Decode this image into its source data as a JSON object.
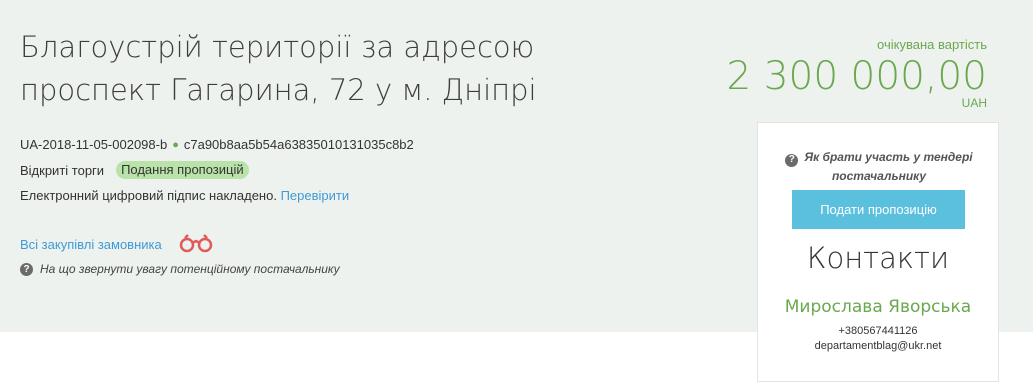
{
  "tender": {
    "title_line1": "Благоустрій території за адресою",
    "title_line2": "проспект Гагарина, 72 у м. Дніпрі",
    "id": "UA-2018-11-05-002098-b",
    "hash": "c7a90b8aa5b54a63835010131035c8b2",
    "procedure": "Відкриті торги",
    "status_badge": "Подання пропозицій",
    "signature_text": "Електронний цифровий підпис накладено.",
    "verify_link": "Перевірити",
    "all_purchases_link": "Всі закупівлі замовника",
    "warning_text": "На що звернути увагу потенційному постачальнику"
  },
  "value": {
    "label": "очікувана вартість",
    "amount": "2 300 000,00",
    "currency": "UAH"
  },
  "sidebar": {
    "how_to_text": "Як брати участь у тендері постачальнику",
    "submit_label": "Подати пропозицію",
    "contacts_title": "Контакти",
    "contact_name": "Мирослава Яворська",
    "contact_phone": "+380567441126",
    "contact_email": "departamentblag@ukr.net"
  },
  "icons": {
    "question": "question-circle-icon",
    "binoculars": "binoculars-icon"
  },
  "colors": {
    "accent_green": "#6aa84f",
    "link_blue": "#3e9ad6",
    "button_blue": "#5bc0de",
    "badge_green": "#b9e3a8",
    "binoculars_red": "#e05a5a"
  }
}
